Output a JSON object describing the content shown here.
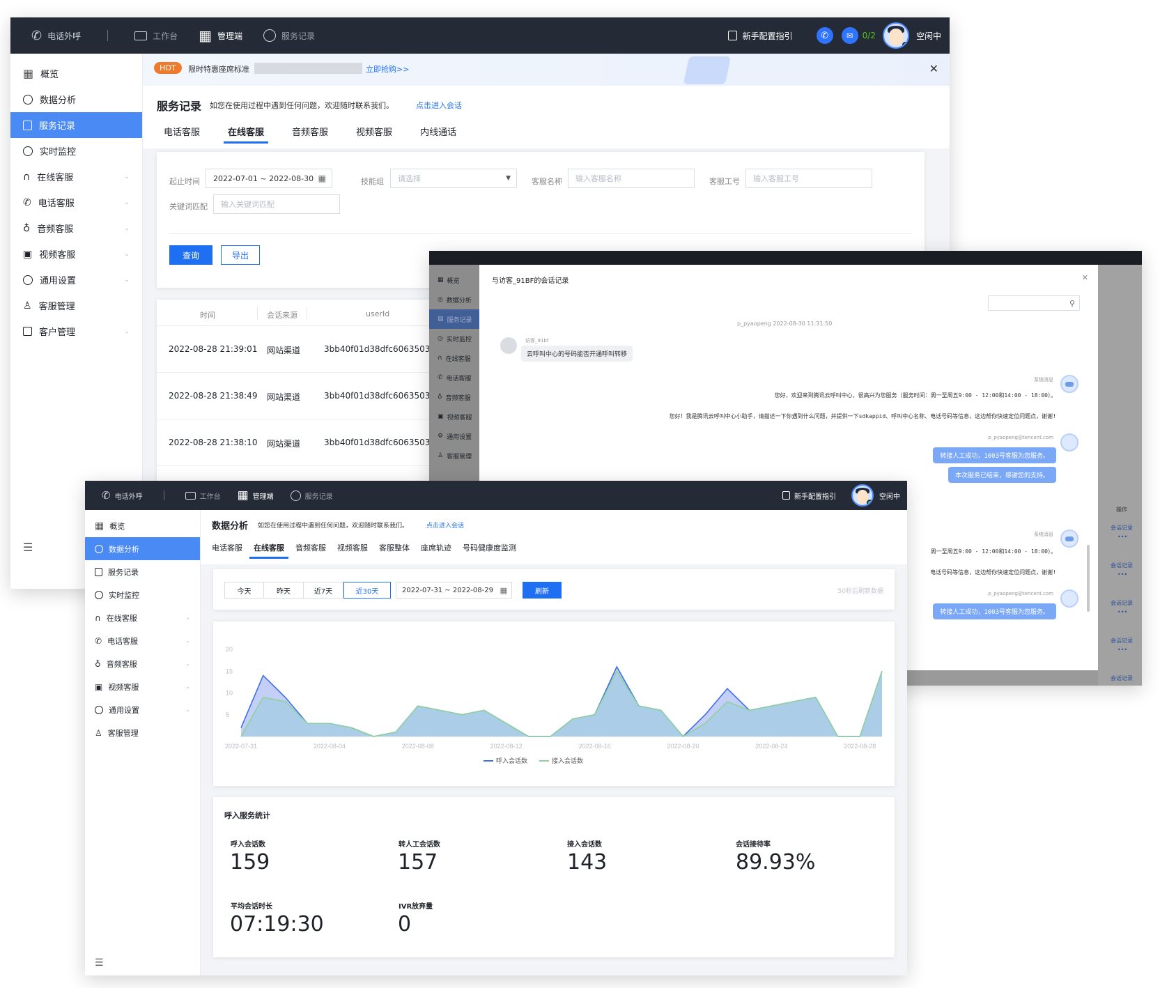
{
  "top_nav": {
    "call_out": "电话外呼",
    "workbench": "工作台",
    "admin": "管理端",
    "service_records": "服务记录",
    "guide": "新手配置指引",
    "queue": "0/2",
    "status": "空闲中"
  },
  "sidebar": {
    "items": [
      {
        "label": "概览"
      },
      {
        "label": "数据分析"
      },
      {
        "label": "服务记录"
      },
      {
        "label": "实时监控"
      },
      {
        "label": "在线客服"
      },
      {
        "label": "电话客服"
      },
      {
        "label": "音频客服"
      },
      {
        "label": "视频客服"
      },
      {
        "label": "通用设置"
      },
      {
        "label": "客服管理"
      },
      {
        "label": "客户管理"
      }
    ]
  },
  "banner": {
    "hot": "HOT",
    "text": "限时特惠座席标准",
    "link": "立即抢购>>"
  },
  "records_page": {
    "title": "服务记录",
    "hint": "如您在使用过程中遇到任何问题，欢迎随时联系我们。",
    "hint_link": "点击进入会话",
    "tabs": [
      "电话客服",
      "在线客服",
      "音频客服",
      "视频客服",
      "内线通话"
    ],
    "filters": {
      "start_label": "起止时间",
      "date_range": "2022-07-01 ~ 2022-08-30",
      "skill_label": "技能组",
      "skill_placeholder": "请选择",
      "agent_name_label": "客服名称",
      "agent_name_placeholder": "输入客服名称",
      "agent_id_label": "客服工号",
      "agent_id_placeholder": "输入客服工号",
      "keyword_label": "关键词匹配",
      "keyword_placeholder": "输入关键词匹配"
    },
    "query_btn": "查询",
    "export_btn": "导出",
    "table": {
      "headers": [
        "时间",
        "会话来源",
        "userId"
      ],
      "rows": [
        [
          "2022-08-28 21:39:01",
          "网站渠道",
          "3bb40f01d38dfc6063503"
        ],
        [
          "2022-08-28 21:38:49",
          "网站渠道",
          "3bb40f01d38dfc6063503"
        ],
        [
          "2022-08-28 21:38:10",
          "网站渠道",
          "3bb40f01d38dfc6063503"
        ]
      ]
    }
  },
  "chat_window": {
    "bg_sidebar": [
      "概览",
      "数据分析",
      "服务记录",
      "实时监控",
      "在线客服",
      "电话客服",
      "音频客服",
      "视频客服",
      "通用设置",
      "客服管理"
    ],
    "title": "与访客_91BF的会话记录",
    "session_meta": "p_pyaopeng 2022-08-30 11:31:50",
    "visitor_name": "访客_91bf",
    "visitor_msg": "云呼叫中心的号码能否开通呼叫转移",
    "sys_label": "系统消息",
    "sys_msg1": "您好，欢迎来到腾讯云呼叫中心，很高兴为您服务（服务时间：周一至周五9:00 - 12:00和14:00 - 18:00）。",
    "sys_msg2": "您好！我是腾讯云呼叫中心小助手，请描述一下你遇到什么问题，并提供一下sdkappid、呼叫中心名称、电话号码等信息，这边帮你快速定位问题点，谢谢!",
    "agent_email": "p_pyaopeng@tencent.com",
    "agent_msg1": "转接人工成功，1003号客服为您服务。",
    "agent_msg2": "本次服务已结束，感谢您的支持。",
    "sys_msg1_partial": "周一至周五9:00 - 12:00和14:00 - 18:00）。",
    "sys_msg2_partial": "电话号码等信息，这边帮你快速定位问题点，谢谢!",
    "op_header": "操作",
    "op_link": "会话记录",
    "op_more": "•••"
  },
  "analytics": {
    "title": "数据分析",
    "hint": "如您在使用过程中遇到任何问题，欢迎随时联系我们。",
    "hint_link": "点击进入会话",
    "tabs": [
      "电话客服",
      "在线客服",
      "音频客服",
      "视频客服",
      "客服整体",
      "座席轨迹",
      "号码健康度监测"
    ],
    "ranges": [
      "今天",
      "昨天",
      "近7天",
      "近30天"
    ],
    "date_range": "2022-07-31 ~ 2022-08-29",
    "refresh": "刷新",
    "refresh_hint": "50秒后刷新数据",
    "stats_title": "呼入服务统计",
    "stats": [
      {
        "label": "呼入会话数",
        "value": "159"
      },
      {
        "label": "转人工会话数",
        "value": "157"
      },
      {
        "label": "接入会话数",
        "value": "143"
      },
      {
        "label": "会话接待率",
        "value": "89.93%"
      },
      {
        "label": "平均会话时长",
        "value": "07:19:30"
      },
      {
        "label": "IVR放弃量",
        "value": "0"
      }
    ]
  },
  "chart_data": {
    "type": "area",
    "ylim": [
      0,
      20
    ],
    "y_ticks": [
      5,
      10,
      15,
      20
    ],
    "x_tick_labels": [
      "2022-07-31",
      "2022-08-04",
      "2022-08-08",
      "2022-08-12",
      "2022-08-16",
      "2022-08-20",
      "2022-08-24",
      "2022-08-28"
    ],
    "x": [
      "2022-07-31",
      "2022-08-01",
      "2022-08-02",
      "2022-08-03",
      "2022-08-04",
      "2022-08-05",
      "2022-08-06",
      "2022-08-07",
      "2022-08-08",
      "2022-08-09",
      "2022-08-10",
      "2022-08-11",
      "2022-08-12",
      "2022-08-13",
      "2022-08-14",
      "2022-08-15",
      "2022-08-16",
      "2022-08-17",
      "2022-08-18",
      "2022-08-19",
      "2022-08-20",
      "2022-08-21",
      "2022-08-22",
      "2022-08-23",
      "2022-08-24",
      "2022-08-25",
      "2022-08-26",
      "2022-08-27",
      "2022-08-28",
      "2022-08-29"
    ],
    "series": [
      {
        "name": "呼入会话数",
        "color": "#3f6fe6",
        "fill": "#b9c7f5",
        "values": [
          2,
          14,
          9,
          3,
          3,
          2,
          0,
          1,
          7,
          6,
          5,
          6,
          3,
          0,
          0,
          4,
          5,
          16,
          7,
          6,
          0,
          5,
          11,
          6,
          7,
          8,
          9,
          0,
          0,
          15
        ]
      },
      {
        "name": "接入会话数",
        "color": "#8fd19e",
        "fill": "#a6cce4",
        "values": [
          0,
          9,
          8,
          3,
          3,
          2,
          0,
          1,
          7,
          6,
          5,
          6,
          3,
          0,
          0,
          4,
          5,
          15,
          7,
          6,
          0,
          3,
          8,
          6,
          7,
          8,
          9,
          0,
          0,
          15
        ]
      }
    ],
    "legend": "bottom"
  }
}
